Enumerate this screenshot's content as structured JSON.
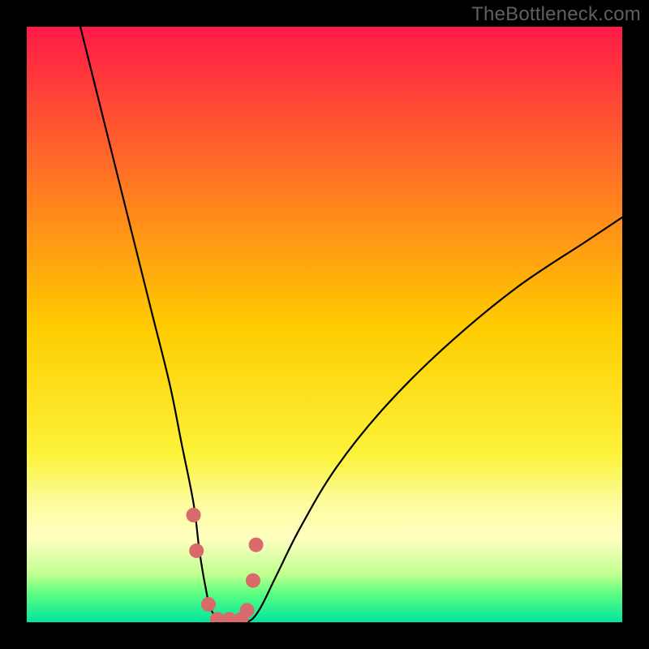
{
  "watermark": "TheBottleneck.com",
  "chart_data": {
    "type": "line",
    "title": "",
    "xlabel": "",
    "ylabel": "",
    "xlim": [
      0,
      100
    ],
    "ylim": [
      0,
      100
    ],
    "grid": false,
    "legend": false,
    "gradient_stops": [
      {
        "offset": 0.0,
        "color": "#ff1a48"
      },
      {
        "offset": 0.5,
        "color": "#ffcb00"
      },
      {
        "offset": 0.72,
        "color": "#fcf33a"
      },
      {
        "offset": 0.8,
        "color": "#fdfca0"
      },
      {
        "offset": 0.86,
        "color": "#ffffc0"
      },
      {
        "offset": 0.92,
        "color": "#c0ff90"
      },
      {
        "offset": 0.95,
        "color": "#60ff80"
      },
      {
        "offset": 1.0,
        "color": "#00e59f"
      }
    ],
    "series": [
      {
        "name": "bottleneck-curve",
        "x": [
          9,
          12,
          15,
          18,
          21,
          24,
          26,
          28,
          29,
          30,
          31,
          33,
          35,
          37,
          39,
          42,
          46,
          52,
          60,
          70,
          82,
          94,
          100
        ],
        "y": [
          100,
          88,
          76,
          64,
          52,
          40,
          30,
          20,
          12,
          6,
          2,
          0,
          0,
          0,
          2,
          8,
          16,
          26,
          36,
          46,
          56,
          64,
          68
        ]
      }
    ],
    "markers": {
      "name": "highlight-points",
      "x": [
        28,
        28.5,
        30.5,
        32,
        34,
        36,
        37,
        38,
        38.5
      ],
      "y": [
        18,
        12,
        3,
        0.5,
        0.5,
        0.5,
        2,
        7,
        13
      ],
      "color": "#d96a6a",
      "size": 9
    }
  }
}
